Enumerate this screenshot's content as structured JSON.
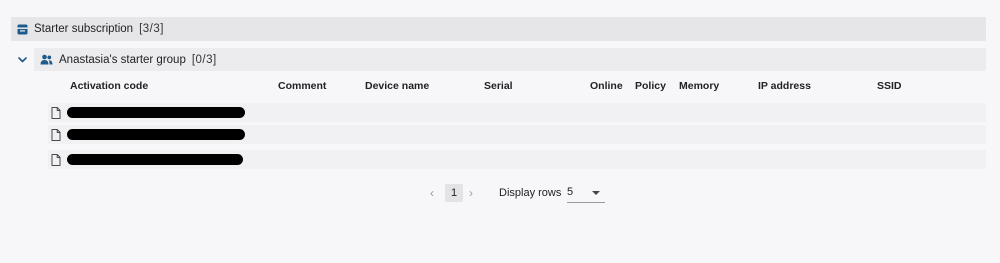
{
  "subscription": {
    "title": "Starter subscription",
    "count": "[3/3]",
    "icon": "subscription-icon"
  },
  "group": {
    "title": "Anastasia's starter group",
    "count": "[0/3]",
    "icon": "users-icon",
    "expand_icon": "chevron-down-icon"
  },
  "table": {
    "columns": [
      "Activation code",
      "Comment",
      "Device name",
      "Serial",
      "Online",
      "Policy",
      "Memory",
      "IP address",
      "SSID"
    ],
    "row_icon": "file-icon",
    "rows": [
      {
        "activation_code_redacted": true
      },
      {
        "activation_code_redacted": true
      },
      {
        "activation_code_redacted": true
      }
    ]
  },
  "pagination": {
    "prev": "‹",
    "current_page": "1",
    "next": "›",
    "rows_label": "Display rows",
    "rows_value": "5"
  },
  "colors": {
    "accent": "#1f5a8c"
  }
}
